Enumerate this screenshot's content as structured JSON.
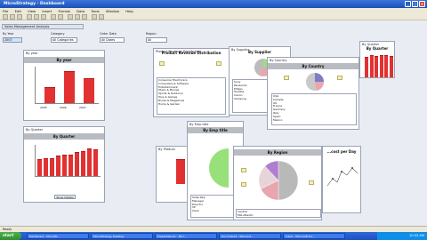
{
  "window": {
    "title": "MicroStrategy - Dashboard"
  },
  "menu": {
    "items": [
      "File",
      "Edit",
      "View",
      "Insert",
      "Format",
      "Data",
      "Tools",
      "Window",
      "Help"
    ]
  },
  "tab": {
    "label": "Sales Management Analysis"
  },
  "filters": [
    {
      "label": "By Year",
      "value": "2007"
    },
    {
      "label": "Category",
      "value": "All Categories"
    },
    {
      "label": "Order Date",
      "value": "All Dates"
    },
    {
      "label": "Region",
      "value": "All"
    }
  ],
  "panels": {
    "by_year": {
      "caption": "By year",
      "title": "By year",
      "button": "Show Details"
    },
    "by_quarter_left": {
      "caption": "By Quarter",
      "title": "By Quarter",
      "button": "Show Details"
    },
    "product_dist": {
      "caption": "Product Revenue Distribution",
      "title": "Product Revenue Distribution",
      "legend": [
        "Consumer Electronics",
        "Computers & Software",
        "Entertainment",
        "Music & Movies",
        "Sports & Outdoors",
        "Toys & Games",
        "Books & Magazines",
        "Home & Garden"
      ]
    },
    "by_supplier": {
      "caption": "By Supplier",
      "title": "By Supplier",
      "legend": [
        "Sony",
        "Panasonic",
        "Philips",
        "Toshiba",
        "Canon",
        "Samsung"
      ]
    },
    "by_country": {
      "caption": "By Country",
      "title": "By Country",
      "legend": [
        "USA",
        "Canada",
        "UK",
        "France",
        "Germany",
        "Italy",
        "Spain",
        "Mexico",
        "Japan",
        "Australia",
        "Brazil",
        "Other"
      ]
    },
    "by_quarter_right": {
      "caption": "By Quarter",
      "title": "By Quarter"
    },
    "by_emp_title": {
      "caption": "By Emp title",
      "title": "By Emp title",
      "legend": [
        "Sales Rep",
        "Manager",
        "Director",
        "VP",
        "Clerk",
        "Analyst"
      ],
      "button": "Show Details"
    },
    "by_region": {
      "title": "By Region",
      "legend": [
        "Central",
        "Mid-Atlantic",
        "North",
        "Northeast",
        "Northwest",
        "South",
        "Southeast",
        "Southwest",
        "Web"
      ]
    },
    "by_product": {
      "caption": "By Product"
    },
    "per_day": {
      "title": "...cost per Day"
    }
  },
  "status": {
    "text": "Ready"
  },
  "taskbar": {
    "start": "start",
    "tasks": [
      "Dashboard - MicroStr...",
      "MicroStrategy Desktop",
      "Presentation1 - Micr...",
      "Document1 - Microsof...",
      "Inbox - Microsoft Ou..."
    ],
    "clock": "10:33 AM"
  },
  "colors": {
    "bar": "#e23131",
    "pie_green": "#98e07a",
    "pie_pink": "#e7a6b0",
    "pie_gray": "#b9b9b9"
  },
  "chart_data": [
    {
      "type": "bar",
      "title": "By year",
      "categories": [
        "2005",
        "2006",
        "2007"
      ],
      "values": [
        45,
        90,
        70
      ],
      "ylim": [
        0,
        100
      ]
    },
    {
      "type": "bar",
      "title": "By Quarter",
      "categories": [
        "Q1",
        "Q2",
        "Q3",
        "Q4",
        "Q5",
        "Q6",
        "Q7",
        "Q8",
        "Q9",
        "Q10"
      ],
      "values": [
        55,
        60,
        58,
        68,
        72,
        70,
        78,
        82,
        92,
        88
      ],
      "ylim": [
        0,
        100
      ]
    },
    {
      "type": "bar",
      "title": "By Quarter",
      "categories": [
        "Q1",
        "Q2",
        "Q3",
        "Q4",
        "Q5",
        "Q6"
      ],
      "values": [
        90,
        95,
        92,
        95,
        96,
        94
      ],
      "ylim": [
        0,
        100
      ]
    },
    {
      "type": "pie",
      "title": "By Region",
      "labels": [
        "Central",
        "South",
        "Northeast",
        "Web"
      ],
      "values": [
        50,
        18,
        20,
        12
      ]
    }
  ]
}
